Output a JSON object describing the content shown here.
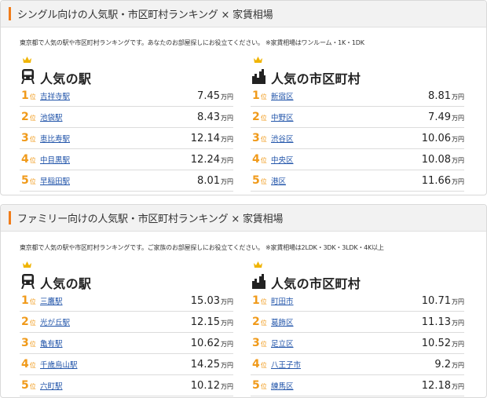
{
  "sections": [
    {
      "title": "シングル向けの人気駅・市区町村ランキング × 家賃相場",
      "description": "東京都で人気の駅や市区町村ランキングです。あなたのお部屋探しにお役立てください。 ※家賃相場はワンルーム・1K・1DK",
      "stations": {
        "heading": "人気の駅",
        "rank_suffix": "位",
        "unit": "万円",
        "items": [
          {
            "rank": "1",
            "name": "吉祥寺駅",
            "value": "7.45"
          },
          {
            "rank": "2",
            "name": "池袋駅",
            "value": "8.43"
          },
          {
            "rank": "3",
            "name": "恵比寿駅",
            "value": "12.14"
          },
          {
            "rank": "4",
            "name": "中目黒駅",
            "value": "12.24"
          },
          {
            "rank": "5",
            "name": "早稲田駅",
            "value": "8.01"
          }
        ]
      },
      "cities": {
        "heading": "人気の市区町村",
        "rank_suffix": "位",
        "unit": "万円",
        "items": [
          {
            "rank": "1",
            "name": "新宿区",
            "value": "8.81"
          },
          {
            "rank": "2",
            "name": "中野区",
            "value": "7.49"
          },
          {
            "rank": "3",
            "name": "渋谷区",
            "value": "10.06"
          },
          {
            "rank": "4",
            "name": "中央区",
            "value": "10.08"
          },
          {
            "rank": "5",
            "name": "港区",
            "value": "11.66"
          }
        ]
      }
    },
    {
      "title": "ファミリー向けの人気駅・市区町村ランキング × 家賃相場",
      "description": "東京都で人気の駅や市区町村ランキングです。ご家族のお部屋探しにお役立てください。 ※家賃相場は2LDK・3DK・3LDK・4K以上",
      "stations": {
        "heading": "人気の駅",
        "rank_suffix": "位",
        "unit": "万円",
        "items": [
          {
            "rank": "1",
            "name": "三鷹駅",
            "value": "15.03"
          },
          {
            "rank": "2",
            "name": "光が丘駅",
            "value": "12.15"
          },
          {
            "rank": "3",
            "name": "亀有駅",
            "value": "10.62"
          },
          {
            "rank": "4",
            "name": "千歳烏山駅",
            "value": "14.25"
          },
          {
            "rank": "5",
            "name": "六町駅",
            "value": "10.12"
          }
        ]
      },
      "cities": {
        "heading": "人気の市区町村",
        "rank_suffix": "位",
        "unit": "万円",
        "items": [
          {
            "rank": "1",
            "name": "町田市",
            "value": "10.71"
          },
          {
            "rank": "2",
            "name": "葛飾区",
            "value": "11.13"
          },
          {
            "rank": "3",
            "name": "足立区",
            "value": "10.52"
          },
          {
            "rank": "4",
            "name": "八王子市",
            "value": "9.2"
          },
          {
            "rank": "5",
            "name": "練馬区",
            "value": "12.18"
          }
        ]
      }
    }
  ],
  "colors": {
    "accent": "#f07c1a",
    "rank": "#f09a1a",
    "link": "#2255aa",
    "crown": "#f0b400"
  },
  "icons": {
    "station": "train-icon",
    "city": "city-map-icon",
    "crown": "crown-icon"
  }
}
